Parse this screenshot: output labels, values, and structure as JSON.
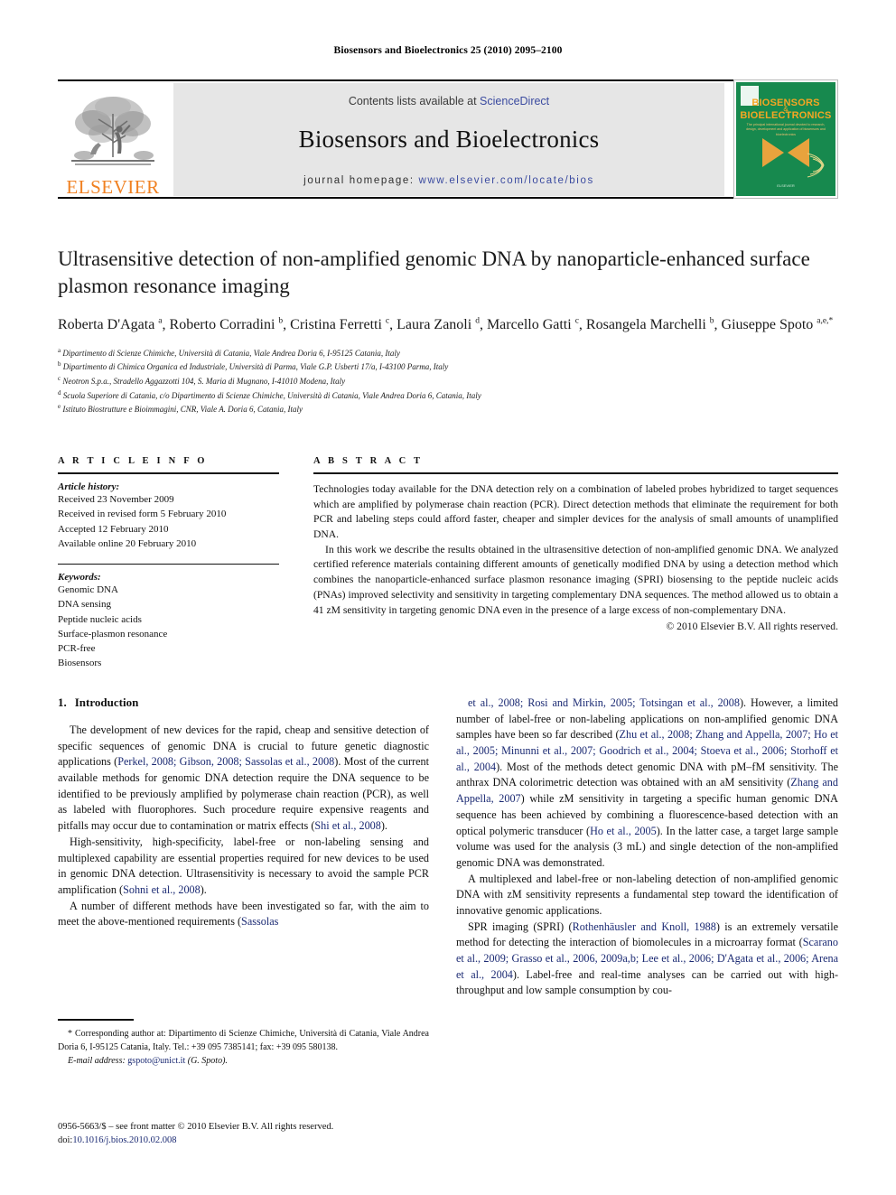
{
  "running_head": "Biosensors and Bioelectronics 25 (2010) 2095–2100",
  "masthead": {
    "publisher_name": "ELSEVIER",
    "contents_prefix": "Contents lists available at ",
    "contents_link": "ScienceDirect",
    "journal_title": "Biosensors and Bioelectronics",
    "homepage_prefix": "journal homepage:",
    "homepage_url": "www.elsevier.com/locate/bios",
    "cover": {
      "line1": "BIOSENSORS",
      "plus": "&",
      "line2": "BIOELECTRONICS",
      "subtitle": "The principal international journal devoted to research, design, development and application of biosensors and bioelectronics",
      "footer": "ELSEVIER"
    }
  },
  "article": {
    "title": "Ultrasensitive detection of non-amplified genomic DNA by nanoparticle-enhanced surface plasmon resonance imaging",
    "authors_html": "Roberta D'Agata <sup>a</sup>, Roberto Corradini <sup>b</sup>, Cristina Ferretti <sup>c</sup>, Laura Zanoli <sup>d</sup>, Marcello Gatti <sup>c</sup>, Rosangela Marchelli <sup>b</sup>, Giuseppe Spoto <sup>a,e,</sup><sup>*</sup>",
    "affiliations": [
      {
        "marker": "a",
        "text": "Dipartimento di Scienze Chimiche, Università di Catania, Viale Andrea Doria 6, I-95125 Catania, Italy"
      },
      {
        "marker": "b",
        "text": "Dipartimento di Chimica Organica ed Industriale, Università di Parma, Viale G.P. Usberti 17/a, I-43100 Parma, Italy"
      },
      {
        "marker": "c",
        "text": "Neotron S.p.a., Stradello Aggazzotti 104, S. Maria di Mugnano, I-41010 Modena, Italy"
      },
      {
        "marker": "d",
        "text": "Scuola Superiore di Catania, c/o Dipartimento di Scienze Chimiche, Università di Catania, Viale Andrea Doria 6, Catania, Italy"
      },
      {
        "marker": "e",
        "text": "Istituto Biostrutture e Bioimmagini, CNR, Viale A. Doria 6, Catania, Italy"
      }
    ]
  },
  "article_info": {
    "heading": "A R T I C L E    I N F O",
    "history_label": "Article history:",
    "history": [
      "Received 23 November 2009",
      "Received in revised form 5 February 2010",
      "Accepted 12 February 2010",
      "Available online 20 February 2010"
    ],
    "keywords_label": "Keywords:",
    "keywords": [
      "Genomic DNA",
      "DNA sensing",
      "Peptide nucleic acids",
      "Surface-plasmon resonance",
      "PCR-free",
      "Biosensors"
    ]
  },
  "abstract": {
    "heading": "A B S T R A C T",
    "paragraph1": "Technologies today available for the DNA detection rely on a combination of labeled probes hybridized to target sequences which are amplified by polymerase chain reaction (PCR). Direct detection methods that eliminate the requirement for both PCR and labeling steps could afford faster, cheaper and simpler devices for the analysis of small amounts of unamplified DNA.",
    "paragraph2": "In this work we describe the results obtained in the ultrasensitive detection of non-amplified genomic DNA. We analyzed certified reference materials containing different amounts of genetically modified DNA by using a detection method which combines the nanoparticle-enhanced surface plasmon resonance imaging (SPRI) biosensing to the peptide nucleic acids (PNAs) improved selectivity and sensitivity in targeting complementary DNA sequences. The method allowed us to obtain a 41 zM sensitivity in targeting genomic DNA even in the presence of a large excess of non-complementary DNA.",
    "copyright": "© 2010 Elsevier B.V. All rights reserved."
  },
  "body": {
    "section_number": "1.",
    "section_title": "Introduction",
    "left_paragraphs_html": [
      "The development of new devices for the rapid, cheap and sensitive detection of specific sequences of genomic DNA is crucial to future genetic diagnostic applications (<span class=\"cite\">Perkel, 2008; Gibson, 2008; Sassolas et al., 2008</span>). Most of the current available methods for genomic DNA detection require the DNA sequence to be identified to be previously amplified by polymerase chain reaction (PCR), as well as labeled with fluorophores. Such procedure require expensive reagents and pitfalls may occur due to contamination or matrix effects (<span class=\"cite\">Shi et al., 2008</span>).",
      "High-sensitivity, high-specificity, label-free or non-labeling sensing and multiplexed capability are essential properties required for new devices to be used in genomic DNA detection. Ultrasensitivity is necessary to avoid the sample PCR amplification (<span class=\"cite\">Sohni et al., 2008</span>).",
      "A number of different methods have been investigated so far, with the aim to meet the above-mentioned requirements (<span class=\"cite\">Sassolas</span>"
    ],
    "right_paragraphs_html": [
      "<span class=\"cite\">et al., 2008; Rosi and Mirkin, 2005; Totsingan et al., 2008</span>). However, a limited number of label-free or non-labeling applications on non-amplified genomic DNA samples have been so far described (<span class=\"cite\">Zhu et al., 2008; Zhang and Appella, 2007; Ho et al., 2005; Minunni et al., 2007; Goodrich et al., 2004; Stoeva et al., 2006; Storhoff et al., 2004</span>). Most of the methods detect genomic DNA with pM–fM sensitivity. The anthrax DNA colorimetric detection was obtained with an aM sensitivity (<span class=\"cite\">Zhang and Appella, 2007</span>) while zM sensitivity in targeting a specific human genomic DNA sequence has been achieved by combining a fluorescence-based detection with an optical polymeric transducer (<span class=\"cite\">Ho et al., 2005</span>). In the latter case, a target large sample volume was used for the analysis (3 mL) and single detection of the non-amplified genomic DNA was demonstrated.",
      "A multiplexed and label-free or non-labeling detection of non-amplified genomic DNA with zM sensitivity represents a fundamental step toward the identification of innovative genomic applications.",
      "SPR imaging (SPRI) (<span class=\"cite\">Rothenhäusler and Knoll, 1988</span>) is an extremely versatile method for detecting the interaction of biomolecules in a microarray format (<span class=\"cite\">Scarano et al., 2009; Grasso et al., 2006, 2009a,b; Lee et al., 2006; D'Agata et al., 2006; Arena et al., 2004</span>). Label-free and real-time analyses can be carried out with high-throughput and low sample consumption by cou-"
    ]
  },
  "footnote": {
    "star": "*",
    "text": "Corresponding author at: Dipartimento di Scienze Chimiche, Università di Catania, Viale Andrea Doria 6, I-95125 Catania, Italy. Tel.: +39 095 7385141; fax: +39 095 580138.",
    "email_label": "E-mail address:",
    "email": "gspoto@unict.it",
    "email_owner": "(G. Spoto)."
  },
  "page_footer": {
    "issn_line": "0956-5663/$ – see front matter © 2010 Elsevier B.V. All rights reserved.",
    "doi_label": "doi:",
    "doi": "10.1016/j.bios.2010.02.008"
  }
}
